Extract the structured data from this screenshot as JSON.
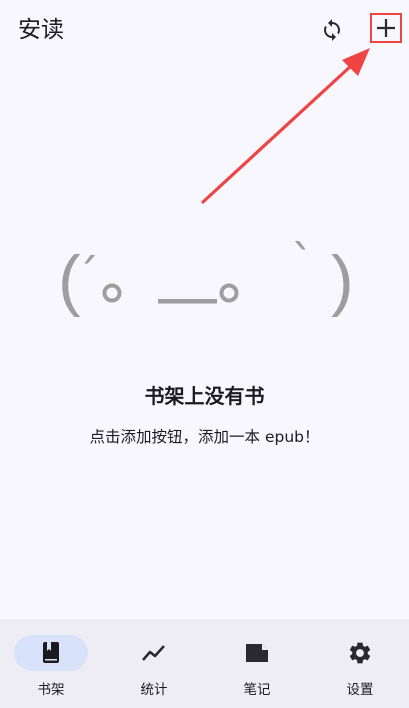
{
  "app": {
    "title": "安读"
  },
  "empty_state": {
    "face": {
      "left_paren": "(",
      "left_tick": "´",
      "left_eye": "。",
      "mouth": "＿＿",
      "right_eye": "。",
      "right_tick": "`",
      "right_paren": ")"
    },
    "title": "书架上没有书",
    "hint": "点击添加按钮，添加一本 epub！"
  },
  "bottom_nav": {
    "items": [
      {
        "label": "书架",
        "icon": "book-icon",
        "active": true
      },
      {
        "label": "统计",
        "icon": "trend-icon",
        "active": false
      },
      {
        "label": "笔记",
        "icon": "note-icon",
        "active": false
      },
      {
        "label": "设置",
        "icon": "gear-icon",
        "active": false
      }
    ]
  },
  "colors": {
    "background": "#f7f7fd",
    "nav_background": "#eeedf4",
    "active_pill": "#d8e2fb",
    "highlight_red": "#ef4444",
    "face_gray": "#9e9e9e"
  }
}
